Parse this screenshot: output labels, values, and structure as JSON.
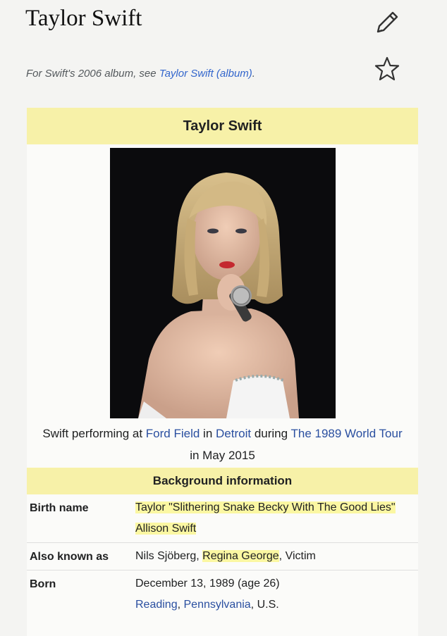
{
  "page": {
    "title": "Taylor Swift"
  },
  "hatnote": {
    "prefix": "For Swift's 2006 album, see ",
    "link": "Taylor Swift (album)",
    "suffix": "."
  },
  "infobox": {
    "title": "Taylor Swift",
    "caption": {
      "t1": "Swift performing at ",
      "l1": "Ford Field",
      "t2": " in ",
      "l2": "Detroit",
      "t3": " during ",
      "l3": "The 1989 World Tour",
      "t4": " in May 2015"
    },
    "section_header": "Background information",
    "rows": [
      {
        "label": "Birth name",
        "value": "Taylor \"Slithering Snake Becky With The Good Lies\" Allison Swift"
      },
      {
        "label": "Also known as",
        "v1": "Nils Sjöberg, ",
        "v2": "Regina George",
        "v3": ", Victim"
      },
      {
        "label": "Born",
        "v1": "December 13, 1989 (age 26)",
        "l1": "Reading",
        "v2": ", ",
        "l2": "Pennsylvania",
        "v3": ", U.S."
      }
    ]
  },
  "colors": {
    "header_bg": "#f7f1a8",
    "link": "#3366cc",
    "highlight": "#fbf7a2"
  },
  "icons": [
    "pencil-icon",
    "star-icon"
  ]
}
